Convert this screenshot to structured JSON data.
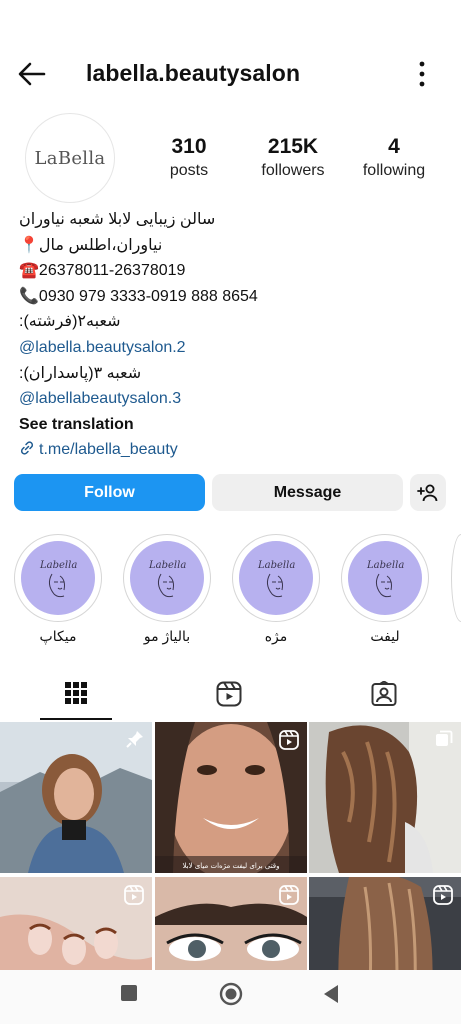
{
  "header": {
    "username": "labella.beautysalon"
  },
  "profile": {
    "avatar_text": "LaBella",
    "stats": [
      {
        "value": "310",
        "label": "posts"
      },
      {
        "value": "215K",
        "label": "followers"
      },
      {
        "value": "4",
        "label": "following"
      }
    ]
  },
  "bio": {
    "line1": "سالن زیبایی لابلا شعبه نیاوران",
    "line2_emoji": "📍",
    "line2": "نیاوران،اطلس مال",
    "line3_emoji": "☎️",
    "line3": "26378011-26378019",
    "line4_emoji": "📞",
    "line4": "0930 979 3333-0919 888 8654",
    "line5": "شعبه۲(فرشته):",
    "line6": "@labella.beautysalon.2",
    "line7": "شعبه ۳(پاسداران):",
    "line8": "@labellabeautysalon.3",
    "translate": "See translation",
    "link": "t.me/labella_beauty"
  },
  "actions": {
    "follow": "Follow",
    "message": "Message"
  },
  "highlights": [
    {
      "label": "میکاپ"
    },
    {
      "label": "بالیاژ مو"
    },
    {
      "label": "مژه"
    },
    {
      "label": "لیفت"
    }
  ],
  "grid_caption": "وقتی برای لیفت مژه‌ات میای لابلا",
  "colors": {
    "primary": "#1c95f2",
    "link": "#1f5a8f",
    "highlight_fill": "#b7b1ef"
  }
}
